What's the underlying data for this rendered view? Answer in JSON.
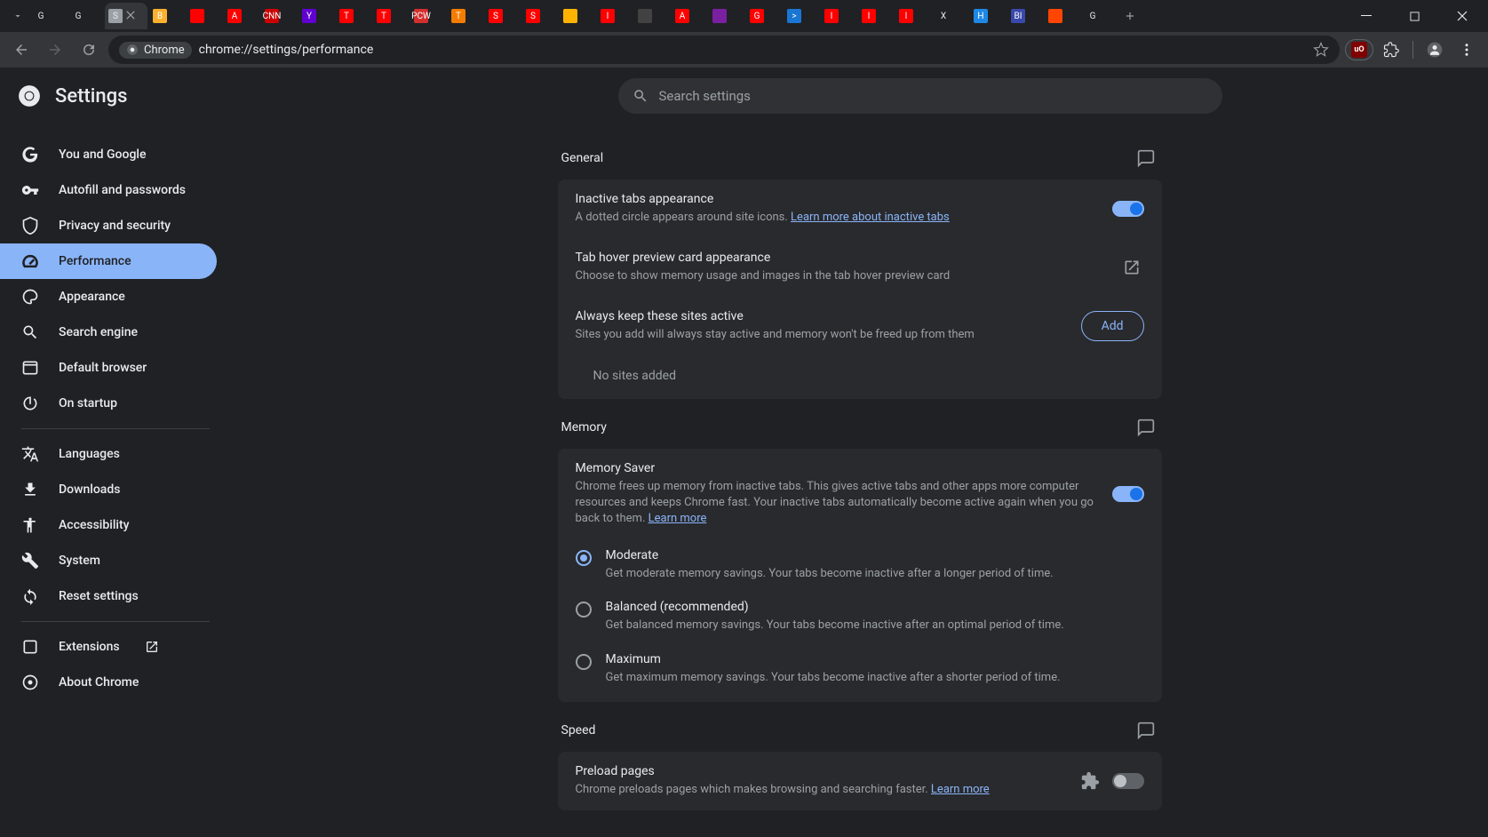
{
  "browser": {
    "url": "chrome://settings/performance",
    "chrome_label": "Chrome",
    "tabs": [
      {
        "label": "G",
        "color": "#fff"
      },
      {
        "label": "G",
        "color": "#fff"
      },
      {
        "label": "S",
        "color": "#9aa0a6",
        "active": true
      },
      {
        "label": "B",
        "color": "#ffb02e"
      },
      {
        "label": "",
        "color": "#ff0000"
      },
      {
        "label": "A",
        "color": "#ff0000"
      },
      {
        "label": "CNN",
        "color": "#cc0000"
      },
      {
        "label": "Y",
        "color": "#6001d2"
      },
      {
        "label": "T",
        "color": "#ff0000"
      },
      {
        "label": "T",
        "color": "#ff0000"
      },
      {
        "label": "PCW",
        "color": "#d32f2f"
      },
      {
        "label": "T",
        "color": "#f57c00"
      },
      {
        "label": "S",
        "color": "#ff0000"
      },
      {
        "label": "S",
        "color": "#ff0000"
      },
      {
        "label": "",
        "color": "#ffb300"
      },
      {
        "label": "I",
        "color": "#ff0000"
      },
      {
        "label": "",
        "color": "#424242"
      },
      {
        "label": "A",
        "color": "#ff0000"
      },
      {
        "label": "",
        "color": "#7b1fa2"
      },
      {
        "label": "G",
        "color": "#ff0000"
      },
      {
        "label": ">",
        "color": "#1976d2"
      },
      {
        "label": "I",
        "color": "#ff0000"
      },
      {
        "label": "I",
        "color": "#ff0000"
      },
      {
        "label": "I",
        "color": "#ff0000"
      },
      {
        "label": "X",
        "color": "#fff"
      },
      {
        "label": "H",
        "color": "#1e88e5"
      },
      {
        "label": "BI",
        "color": "#3949ab"
      },
      {
        "label": "",
        "color": "#ff4500"
      },
      {
        "label": "G",
        "color": "#fff"
      }
    ]
  },
  "header": {
    "title": "Settings"
  },
  "search": {
    "placeholder": "Search settings"
  },
  "sidebar": {
    "items": [
      {
        "label": "You and Google"
      },
      {
        "label": "Autofill and passwords"
      },
      {
        "label": "Privacy and security"
      },
      {
        "label": "Performance"
      },
      {
        "label": "Appearance"
      },
      {
        "label": "Search engine"
      },
      {
        "label": "Default browser"
      },
      {
        "label": "On startup"
      }
    ],
    "items2": [
      {
        "label": "Languages"
      },
      {
        "label": "Downloads"
      },
      {
        "label": "Accessibility"
      },
      {
        "label": "System"
      },
      {
        "label": "Reset settings"
      }
    ],
    "items3": [
      {
        "label": "Extensions"
      },
      {
        "label": "About Chrome"
      }
    ]
  },
  "general": {
    "heading": "General",
    "inactive_tabs": {
      "title": "Inactive tabs appearance",
      "desc": "A dotted circle appears around site icons. ",
      "link": "Learn more about inactive tabs"
    },
    "hover_preview": {
      "title": "Tab hover preview card appearance",
      "desc": "Choose to show memory usage and images in the tab hover preview card"
    },
    "always_active": {
      "title": "Always keep these sites active",
      "desc": "Sites you add will always stay active and memory won't be freed up from them",
      "add_label": "Add",
      "empty": "No sites added"
    }
  },
  "memory": {
    "heading": "Memory",
    "saver": {
      "title": "Memory Saver",
      "desc": "Chrome frees up memory from inactive tabs. This gives active tabs and other apps more computer resources and keeps Chrome fast. Your inactive tabs automatically become active again when you go back to them. ",
      "link": "Learn more"
    },
    "options": [
      {
        "title": "Moderate",
        "desc": "Get moderate memory savings. Your tabs become inactive after a longer period of time."
      },
      {
        "title": "Balanced (recommended)",
        "desc": "Get balanced memory savings. Your tabs become inactive after an optimal period of time."
      },
      {
        "title": "Maximum",
        "desc": "Get maximum memory savings. Your tabs become inactive after a shorter period of time."
      }
    ]
  },
  "speed": {
    "heading": "Speed",
    "preload": {
      "title": "Preload pages",
      "desc": "Chrome preloads pages which makes browsing and searching faster. ",
      "link": "Learn more"
    }
  }
}
